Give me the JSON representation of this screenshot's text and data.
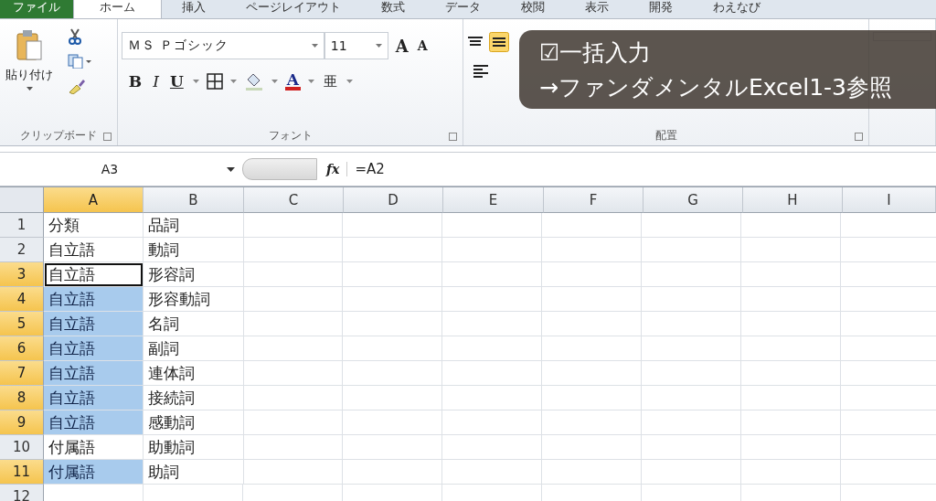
{
  "tabs": [
    {
      "label": "ファイル",
      "kind": "file",
      "selected": false
    },
    {
      "label": "ホーム",
      "kind": "tab",
      "selected": true
    },
    {
      "label": "挿入",
      "kind": "tab",
      "selected": false
    },
    {
      "label": "ページレイアウト",
      "kind": "tab",
      "selected": false
    },
    {
      "label": "数式",
      "kind": "tab",
      "selected": false
    },
    {
      "label": "データ",
      "kind": "tab",
      "selected": false
    },
    {
      "label": "校閲",
      "kind": "tab",
      "selected": false
    },
    {
      "label": "表示",
      "kind": "tab",
      "selected": false
    },
    {
      "label": "開発",
      "kind": "tab",
      "selected": false
    },
    {
      "label": "わえなび",
      "kind": "tab",
      "selected": false
    }
  ],
  "clipboard": {
    "paste": "貼り付け",
    "label": "クリップボード"
  },
  "font": {
    "name": "ＭＳ Ｐゴシック",
    "size": "11",
    "grow": "A",
    "shrink": "A",
    "bold": "B",
    "italic": "I",
    "underline": "U",
    "font_color": "A",
    "phonetic": "亜",
    "label": "フォント"
  },
  "alignment": {
    "label": "配置"
  },
  "formula_bar": {
    "name_box": "A3",
    "fx": "fx",
    "formula": "=A2"
  },
  "sheet": {
    "columns": [
      {
        "label": "A",
        "selected": true
      },
      {
        "label": "B",
        "selected": false
      },
      {
        "label": "C",
        "selected": false
      },
      {
        "label": "D",
        "selected": false
      },
      {
        "label": "E",
        "selected": false
      },
      {
        "label": "F",
        "selected": false
      },
      {
        "label": "G",
        "selected": false
      },
      {
        "label": "H",
        "selected": false
      },
      {
        "label": "I",
        "selected": false
      }
    ],
    "rows": [
      {
        "num": "1",
        "selected": false,
        "a": {
          "text": "分類",
          "selected": false,
          "active": false
        },
        "b": "品詞"
      },
      {
        "num": "2",
        "selected": false,
        "a": {
          "text": "自立語",
          "selected": false,
          "active": false
        },
        "b": "動詞"
      },
      {
        "num": "3",
        "selected": true,
        "a": {
          "text": "自立語",
          "selected": false,
          "active": true
        },
        "b": "形容詞"
      },
      {
        "num": "4",
        "selected": true,
        "a": {
          "text": "自立語",
          "selected": true,
          "active": false
        },
        "b": "形容動詞"
      },
      {
        "num": "5",
        "selected": true,
        "a": {
          "text": "自立語",
          "selected": true,
          "active": false
        },
        "b": "名詞"
      },
      {
        "num": "6",
        "selected": true,
        "a": {
          "text": "自立語",
          "selected": true,
          "active": false
        },
        "b": "副詞"
      },
      {
        "num": "7",
        "selected": true,
        "a": {
          "text": "自立語",
          "selected": true,
          "active": false
        },
        "b": "連体詞"
      },
      {
        "num": "8",
        "selected": true,
        "a": {
          "text": "自立語",
          "selected": true,
          "active": false
        },
        "b": "接続詞"
      },
      {
        "num": "9",
        "selected": true,
        "a": {
          "text": "自立語",
          "selected": true,
          "active": false
        },
        "b": "感動詞"
      },
      {
        "num": "10",
        "selected": false,
        "a": {
          "text": "付属語",
          "selected": false,
          "active": false
        },
        "b": "助動詞"
      },
      {
        "num": "11",
        "selected": true,
        "a": {
          "text": "付属語",
          "selected": true,
          "active": false
        },
        "b": "助詞"
      },
      {
        "num": "12",
        "selected": false
      }
    ]
  },
  "caption": {
    "lines": [
      "☑一括入力",
      "→ファンダメンタルExcel1-3参照"
    ]
  }
}
